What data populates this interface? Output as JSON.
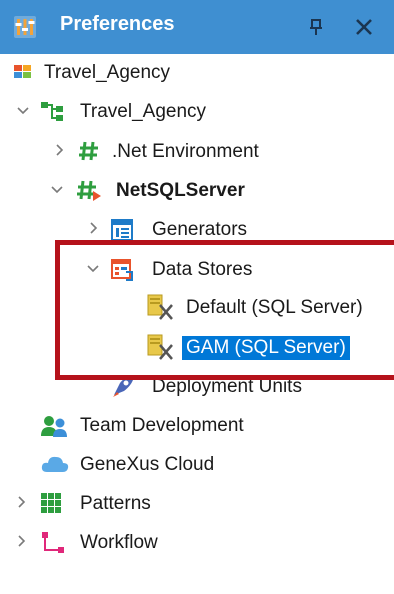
{
  "panel": {
    "title": "Preferences",
    "pin_glyph": "⫫",
    "close_glyph": "✕"
  },
  "tree": {
    "root": "Travel_Agency",
    "version": "Travel_Agency",
    "net_env": ".Net Environment",
    "netsql": "NetSQLServer",
    "generators": "Generators",
    "data_stores": "Data Stores",
    "default_ds": "Default (SQL Server)",
    "gam_ds": "GAM (SQL Server)",
    "deployment": "Deployment Units",
    "team_dev": "Team Development",
    "cloud": "GeneXus Cloud",
    "patterns": "Patterns",
    "workflow": "Workflow"
  },
  "colors": {
    "titlebar": "#3f8fd1",
    "selection": "#0078d7",
    "annotation": "#b5121b"
  },
  "icons": [
    "preferences-icon",
    "pin-icon",
    "close-icon",
    "kb-icon",
    "version-icon",
    "environment-icon",
    "generators-icon",
    "datastores-icon",
    "datastore-icon",
    "deployment-icon",
    "team-icon",
    "cloud-icon",
    "patterns-icon",
    "workflow-icon"
  ]
}
